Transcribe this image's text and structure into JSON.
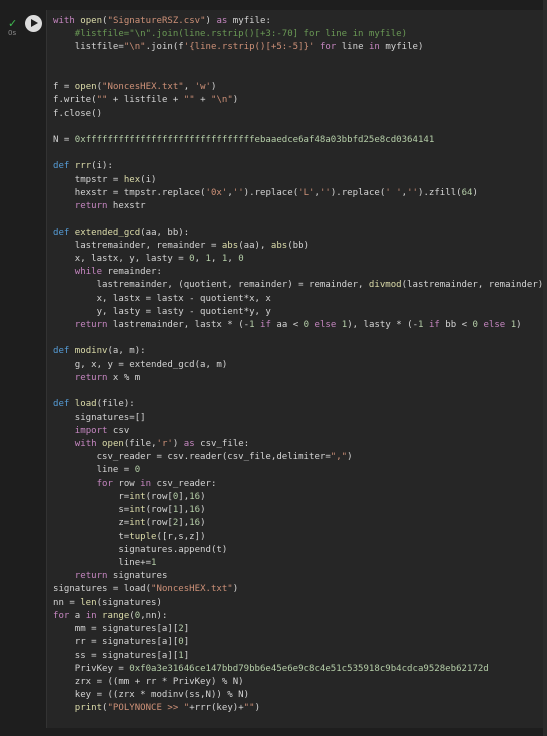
{
  "cell": {
    "status_icon": "✓",
    "status_sub": "0s",
    "run_button": "run-cell-button"
  },
  "code_lines": [
    "with open(\"SignatureRSZ.csv\") as myfile:",
    "    #listfile=\"\\n\".join(line.rstrip()[+3:-70] for line in myfile)",
    "    listfile=\"\\n\".join(f'{line.rstrip()[+5:-5]}' for line in myfile)",
    "",
    "",
    "f = open(\"NoncesHEX.txt\", 'w')",
    "f.write(\"\" + listfile + \"\" + \"\\n\")",
    "f.close()",
    "",
    "N = 0xfffffffffffffffffffffffffffffffebaaedce6af48a03bbfd25e8cd0364141",
    "",
    "def rrr(i):",
    "    tmpstr = hex(i)",
    "    hexstr = tmpstr.replace('0x','').replace('L','').replace(' ','').zfill(64)",
    "    return hexstr",
    "",
    "def extended_gcd(aa, bb):",
    "    lastremainder, remainder = abs(aa), abs(bb)",
    "    x, lastx, y, lasty = 0, 1, 1, 0",
    "    while remainder:",
    "        lastremainder, (quotient, remainder) = remainder, divmod(lastremainder, remainder)",
    "        x, lastx = lastx - quotient*x, x",
    "        y, lasty = lasty - quotient*y, y",
    "    return lastremainder, lastx * (-1 if aa < 0 else 1), lasty * (-1 if bb < 0 else 1)",
    "",
    "def modinv(a, m):",
    "    g, x, y = extended_gcd(a, m)",
    "    return x % m",
    "",
    "def load(file):",
    "    signatures=[]",
    "    import csv",
    "    with open(file,'r') as csv_file:",
    "        csv_reader = csv.reader(csv_file,delimiter=\",\")",
    "        line = 0",
    "        for row in csv_reader:",
    "            r=int(row[0],16)",
    "            s=int(row[1],16)",
    "            z=int(row[2],16)",
    "            t=tuple([r,s,z])",
    "            signatures.append(t)",
    "            line+=1",
    "    return signatures",
    "signatures = load(\"NoncesHEX.txt\")",
    "nn = len(signatures)",
    "for a in range(0,nn):",
    "    mm = signatures[a][2]",
    "    rr = signatures[a][0]",
    "    ss = signatures[a][1]",
    "    PrivKey = 0xf0a3e31646ce147bbd79bb6e45e6e9c8c4e51c535918c9b4cdca9528eb62172d",
    "    zrx = ((mm + rr * PrivKey) % N)",
    "    key = ((zrx * modinv(ss,N)) % N)",
    "    print(\"POLYNONCE >> \"+rrr(key)+\"\")"
  ]
}
